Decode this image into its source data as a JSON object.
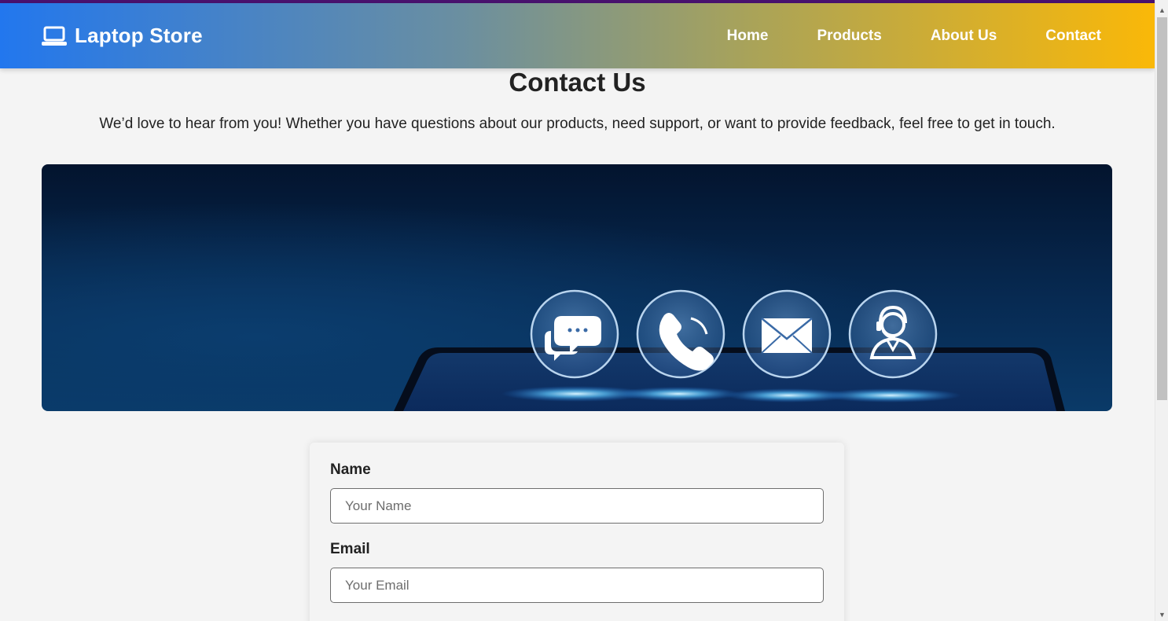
{
  "brand": {
    "name": "Laptop Store",
    "icon": "laptop-icon"
  },
  "nav": {
    "items": [
      {
        "label": "Home"
      },
      {
        "label": "Products"
      },
      {
        "label": "About Us"
      },
      {
        "label": "Contact"
      }
    ]
  },
  "page": {
    "title": "Contact Us",
    "intro": "We’d love to hear from you! Whether you have questions about our products, need support, or want to provide feedback, feel free to get in touch."
  },
  "hero": {
    "icons": [
      "chat-bubbles-icon",
      "phone-icon",
      "envelope-icon",
      "support-agent-icon"
    ]
  },
  "form": {
    "name_label": "Name",
    "name_placeholder": "Your Name",
    "email_label": "Email",
    "email_placeholder": "Your Email"
  },
  "colors": {
    "nav_gradient_start": "#2277ee",
    "nav_gradient_end": "#fab808",
    "page_background": "#f4f4f4"
  }
}
